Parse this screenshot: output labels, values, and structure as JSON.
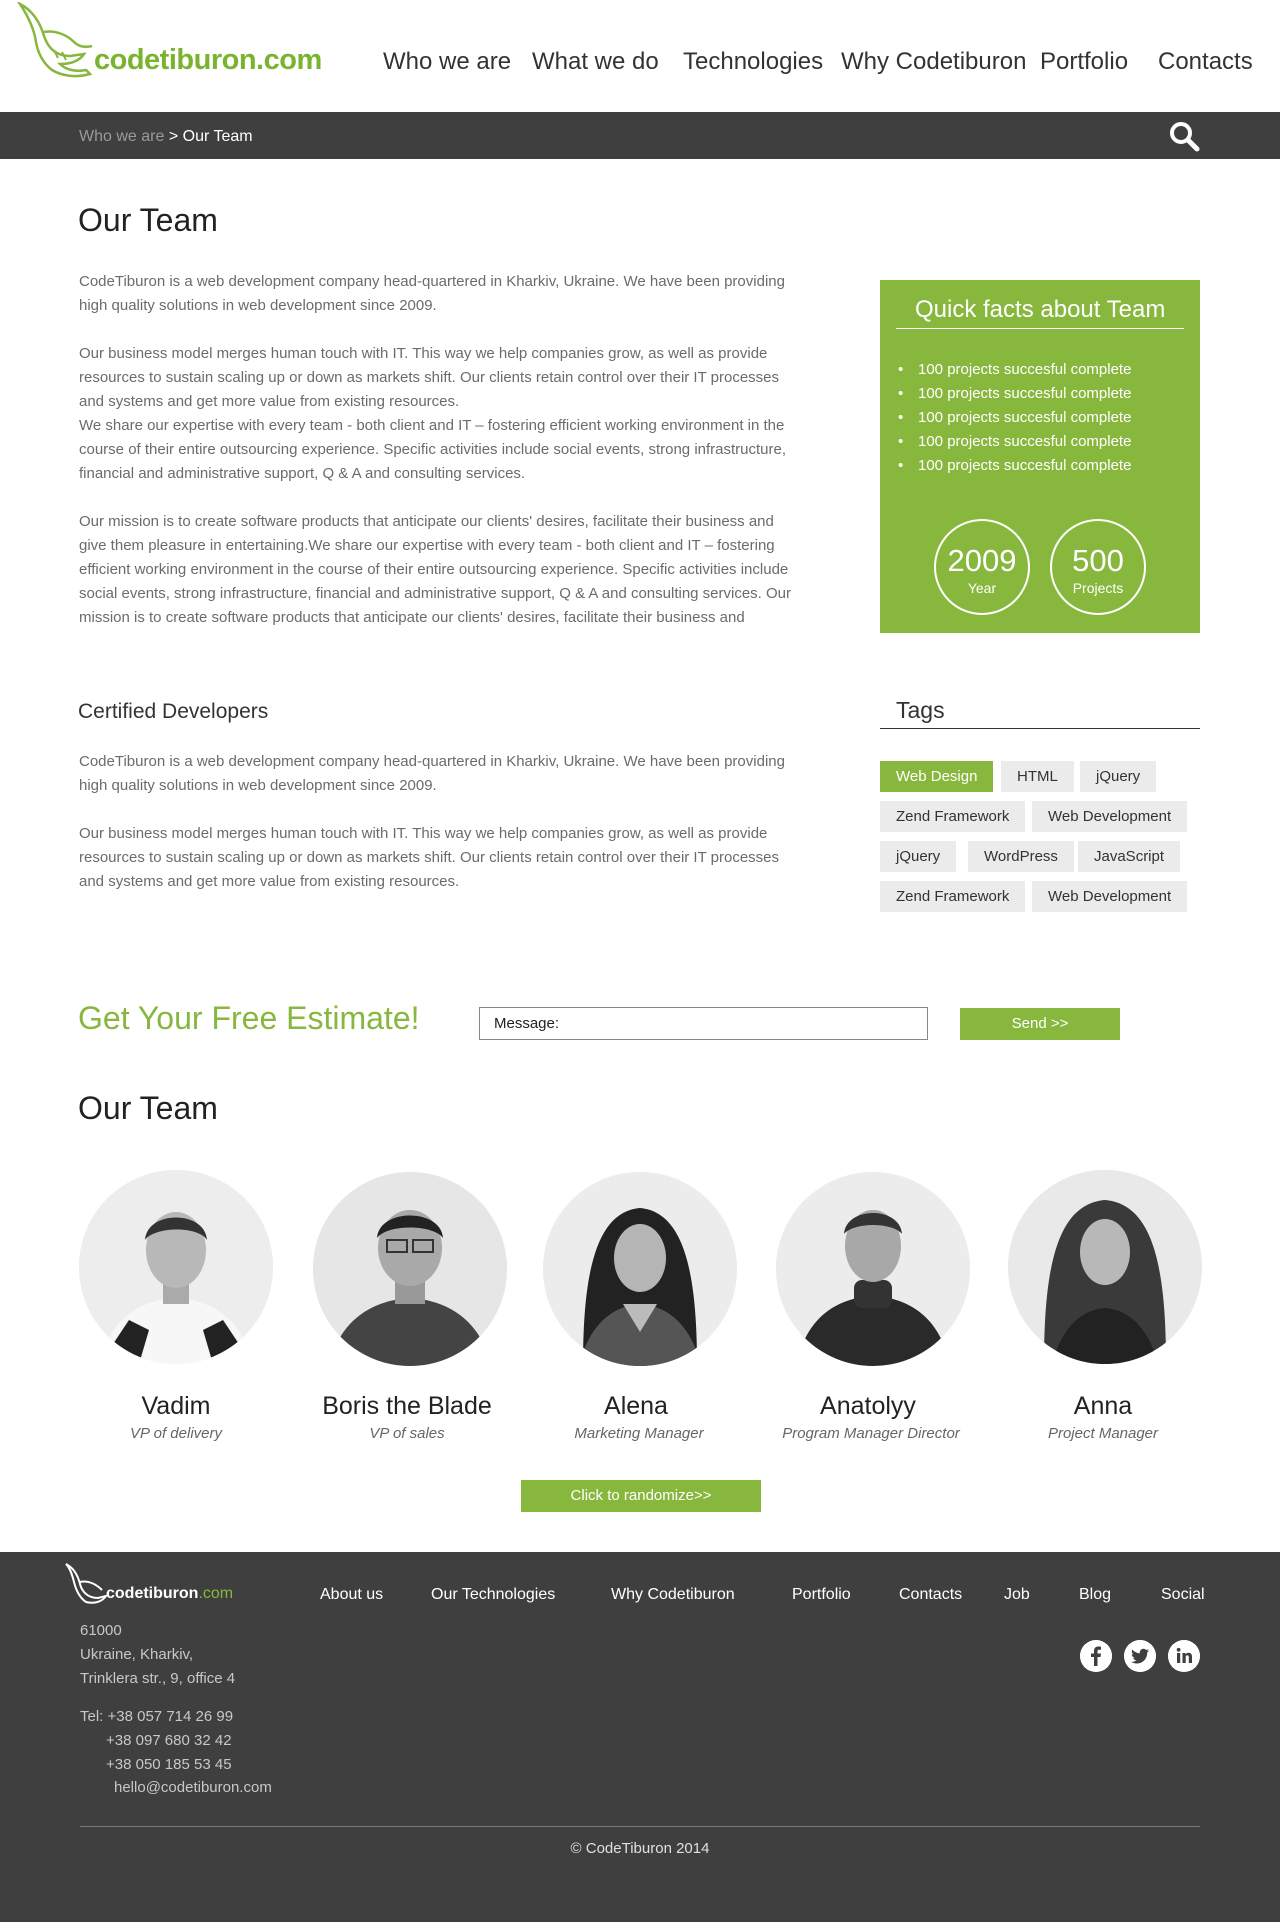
{
  "header": {
    "logo_text": "codetiburon.com",
    "nav": [
      "Who we are",
      "What we do",
      "Technologies",
      "Why Codetiburon",
      "Portfolio",
      "Contacts"
    ]
  },
  "breadcrumb": {
    "parent": "Who we are",
    "separator": ">",
    "current": "Our Team"
  },
  "main": {
    "title": "Our Team",
    "paragraphs": [
      "CodeTiburon is a web development company head-quartered in Kharkiv, Ukraine. We have been providing high quality solutions in web development since 2009.",
      "Our business model merges human touch with IT. This way we help companies grow, as well as provide resources to sustain scaling up or down as markets shift. Our clients retain control over their IT processes and systems and get more value from existing resources.",
      "We share our expertise with every team - both client and IT – fostering efficient working environment in the course of their entire outsourcing experience. Specific activities include social events, strong infrastructure, financial and administrative support, Q & A and consulting services.",
      "Our mission is to create software products that anticipate our clients' desires, facilitate their business and give them pleasure in entertaining.We share our expertise with every team - both client and IT – fostering efficient working environment in the course of their entire outsourcing experience. Specific activities include social events, strong infrastructure, financial and administrative support, Q & A and consulting services. Our mission is to create software products that anticipate our clients' desires, facilitate their business and"
    ]
  },
  "quick_facts": {
    "title": "Quick facts about Team",
    "items": [
      "100 projects succesful complete",
      "100 projects succesful complete",
      "100 projects succesful complete",
      "100 projects succesful complete",
      "100 projects succesful complete"
    ],
    "stats": [
      {
        "value": "2009",
        "label": "Year"
      },
      {
        "value": "500",
        "label": "Projects"
      }
    ]
  },
  "certified": {
    "title": "Certified Developers",
    "paragraphs": [
      "CodeTiburon is a web development company head-quartered in Kharkiv, Ukraine. We have been providing high quality solutions in web development since 2009.",
      "Our business model merges human touch with IT. This way we help companies grow, as well as provide resources to sustain scaling up or down as markets shift. Our clients retain control over their IT processes and systems and get more value from existing resources."
    ]
  },
  "tags": {
    "title": "Tags",
    "items": [
      "Web Design",
      "HTML",
      "jQuery",
      "Zend Framework",
      "Web Development",
      "jQuery",
      "WordPress",
      "JavaScript",
      "Zend Framework",
      "Web Development"
    ],
    "active_color": "#88b73e"
  },
  "estimate": {
    "title": "Get Your Free Estimate!",
    "message_placeholder": "Message:",
    "send_label": "Send >>"
  },
  "team": {
    "title": "Our Team",
    "members": [
      {
        "name": "Vadim",
        "role": "VP of delivery"
      },
      {
        "name": "Boris the Blade",
        "role": "VP of sales"
      },
      {
        "name": "Alena",
        "role": "Marketing Manager"
      },
      {
        "name": "Anatolyy",
        "role": "Program Manager Director"
      },
      {
        "name": "Anna",
        "role": "Project Manager"
      }
    ],
    "randomize_label": "Click to randomize>>"
  },
  "footer": {
    "logo_text": "codetiburon",
    "logo_suffix": ".com",
    "nav": [
      "About us",
      "Our Technologies",
      "Why Codetiburon",
      "Portfolio",
      "Contacts",
      "Job",
      "Blog",
      "Social"
    ],
    "address": [
      "61000",
      "Ukraine, Kharkiv,",
      "Trinklera str., 9, office 4"
    ],
    "phones": [
      "Tel: +38 057 714 26 99",
      "+38 097 680 32 42",
      "+38 050 185 53 45"
    ],
    "email": "hello@codetiburon.com",
    "social": [
      "facebook-icon",
      "twitter-icon",
      "linkedin-icon"
    ],
    "copyright": "© CodeTiburon 2014"
  },
  "colors": {
    "brand_green": "#88b73e",
    "dark_bar": "#3f3f3f"
  }
}
